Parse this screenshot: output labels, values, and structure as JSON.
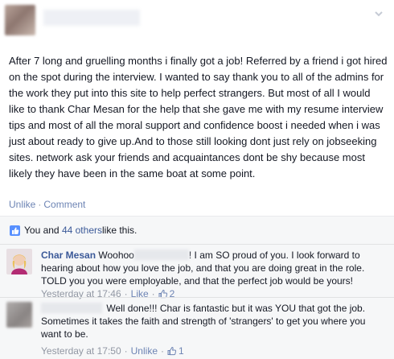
{
  "post": {
    "body": "After 7 long and gruelling months i finally got a job! Referred by a friend i got hired on the spot during the interview. I wanted to say thank you to all of the admins for the work they put into this site to help perfect strangers. But most of all I would like to thank Char Mesan for the help that she gave me with my resume interview tips and most of all the moral support and confidence boost i needed when i was just about ready to give up.And to those still looking dont just rely on jobseeking sites. network ask your friends and acquaintances dont be shy because most likely they have been in the same boat at some point.",
    "actions": {
      "unlike": "Unlike",
      "sep": "·",
      "comment": "Comment"
    }
  },
  "likes": {
    "prefix": "You and ",
    "count_link": "44 others",
    "suffix": " like this."
  },
  "comments": [
    {
      "author": "Char Mesan",
      "text_before": "Woohoo",
      "text_after": "! I am SO proud of you. I look forward to hearing about how you love the job, and that you are doing great in the role. TOLD you you were employable, and that the perfect job would be yours!",
      "timestamp": "Yesterday at 17:46",
      "action": "Like",
      "like_count": "2"
    },
    {
      "author": "",
      "text": "Well done!!! Char is fantastic but it was YOU that got the job. Sometimes it takes the faith and strength of 'strangers' to get you where you want to be.",
      "timestamp": "Yesterday at 17:50",
      "action": "Unlike",
      "like_count": "1"
    }
  ],
  "colors": {
    "link": "#3b5998",
    "action_link": "#6d84b4",
    "meta_gray": "#9197a3",
    "feedback_bg": "#f6f7f8"
  },
  "icons": {
    "menu": "chevron-down-icon",
    "like": "thumbs-up-icon"
  }
}
